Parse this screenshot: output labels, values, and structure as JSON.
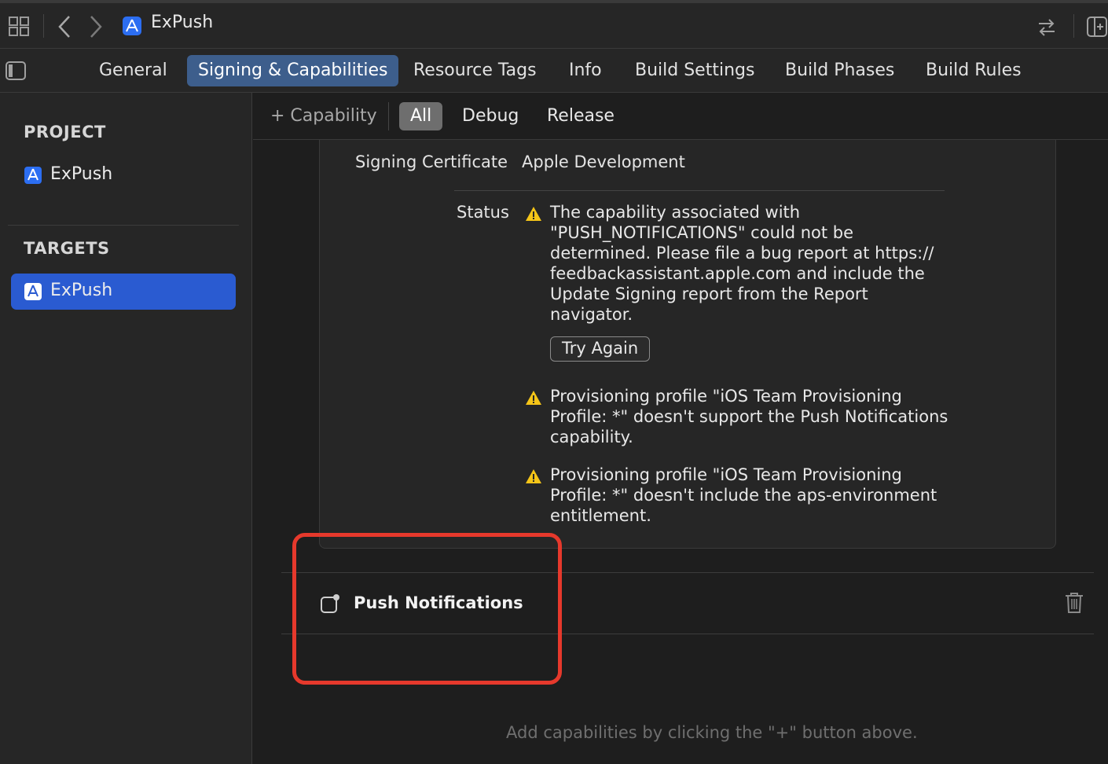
{
  "toolbar": {
    "project_name": "ExPush",
    "icons": [
      "grid-icon",
      "back-icon",
      "forward-icon",
      "app-icon",
      "swap-icon",
      "add-editor-icon"
    ]
  },
  "tabs": [
    {
      "label": "General"
    },
    {
      "label": "Signing & Capabilities"
    },
    {
      "label": "Resource Tags"
    },
    {
      "label": "Info"
    },
    {
      "label": "Build Settings"
    },
    {
      "label": "Build Phases"
    },
    {
      "label": "Build Rules"
    }
  ],
  "sidebar": {
    "project_header": "PROJECT",
    "project_item": "ExPush",
    "targets_header": "TARGETS",
    "target_item": "ExPush"
  },
  "filterbar": {
    "capability_label": "+ Capability",
    "filters": [
      "All",
      "Debug",
      "Release"
    ]
  },
  "signing": {
    "cert_label": "Signing Certificate",
    "cert_value": "Apple Development",
    "status_label": "Status",
    "status_message": "The capability associated with \"PUSH_NOTIFICATIONS\" could not be determined. Please file a bug report at https:// feedbackassistant.apple.com and include the Update Signing report from the Report navigator.",
    "try_again": "Try Again",
    "warning_1": "Provisioning profile \"iOS Team Provisioning Profile: *\" doesn't support the Push Notifications capability.",
    "warning_2": "Provisioning profile \"iOS Team Provisioning Profile: *\" doesn't include the aps-environment entitlement."
  },
  "capability": {
    "title": "Push Notifications"
  },
  "hint": "Add capabilities by clicking the \"+\" button above.",
  "colors": {
    "accent": "#2a5bd1",
    "tab_active": "#3d5e8c",
    "warning": "#f5c518",
    "highlight": "#e6392c"
  }
}
